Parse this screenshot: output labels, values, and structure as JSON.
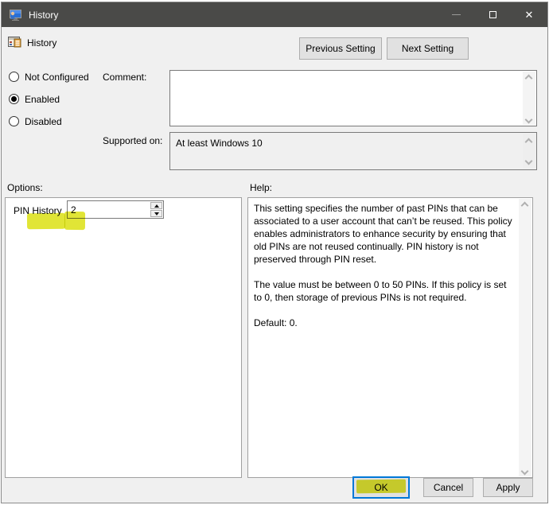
{
  "window": {
    "title": "History",
    "icons": {
      "app": "group-policy-icon",
      "minimize": "minimize-icon",
      "maximize": "maximize-icon",
      "close": "close-icon"
    },
    "close_glyph": "✕"
  },
  "header": {
    "title": "History",
    "prev_button": "Previous Setting",
    "next_button": "Next Setting"
  },
  "radios": [
    {
      "label": "Not Configured",
      "selected": false
    },
    {
      "label": "Enabled",
      "selected": true
    },
    {
      "label": "Disabled",
      "selected": false
    }
  ],
  "comment": {
    "label": "Comment:",
    "value": ""
  },
  "supported": {
    "label": "Supported on:",
    "value": "At least Windows 10"
  },
  "options": {
    "label": "Options:",
    "pin_history_label": "PIN History",
    "pin_history_value": "2"
  },
  "help": {
    "label": "Help:",
    "paragraphs": [
      "This setting specifies the number of past PINs that can be associated to a user account that can’t be reused. This policy enables administrators to enhance security by ensuring that old PINs are not reused continually. PIN history is not preserved through PIN reset.",
      "The value must be between 0 to 50 PINs. If this policy is set to 0, then storage of previous PINs is not required.",
      "Default: 0."
    ]
  },
  "footer": {
    "ok": "OK",
    "cancel": "Cancel",
    "apply": "Apply"
  },
  "colors": {
    "titlebar": "#4a4a48",
    "dialog_bg": "#f0f0f0",
    "focus_accent": "#0078d7",
    "annotation_highlight": "#dfe324",
    "button_bg": "#e1e1e1",
    "button_border": "#adadad"
  }
}
